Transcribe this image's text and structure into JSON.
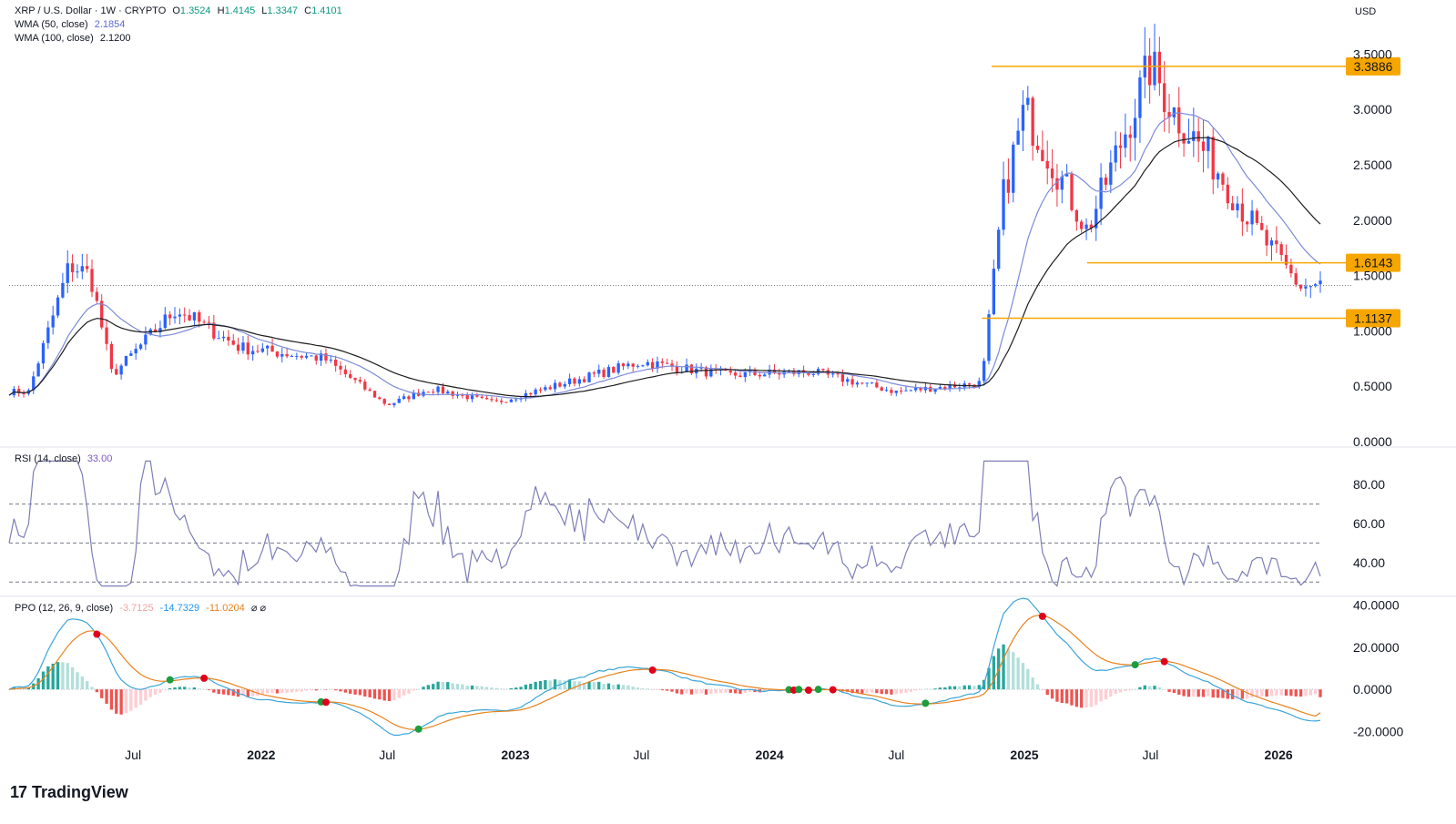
{
  "header": {
    "symbol": "XRP / U.S. Dollar · 1W · CRYPTO",
    "o_label": "O",
    "o_value": "1.3524",
    "h_label": "H",
    "h_value": "1.4145",
    "l_label": "L",
    "l_value": "1.3347",
    "c_label": "C",
    "c_value": "1.4101",
    "currency": "USD"
  },
  "indicators": {
    "wma50_label": "WMA (50, close)",
    "wma50_value": "2.1854",
    "wma100_label": "WMA (100, close)",
    "wma100_value": "2.1200",
    "rsi_label": "RSI (14, close)",
    "rsi_value": "33.00",
    "ppo_label": "PPO (12, 26, 9, close)",
    "ppo_hist": "-3.7125",
    "ppo_line": "-14.7329",
    "ppo_signal": "-11.0204",
    "ppo_icons": "⌀ ⌀"
  },
  "brand": {
    "name": "TradingView"
  },
  "colors": {
    "up": "#2962ff",
    "down": "#f23645",
    "wma50": "#7b8bd8",
    "wma100": "#1e1e1e",
    "level": "#f7a600",
    "rsi": "#7e7eb8",
    "ppo_line": "#3ca5d8",
    "ppo_signal": "#e8821e",
    "hist_up": "#26a69a",
    "hist_down": "#ef5350"
  },
  "chart_data": [
    {
      "type": "candlestick",
      "title": "XRP / U.S. Dollar · 1W · CRYPTO",
      "ylim": [
        0,
        3.7
      ],
      "y_ticks": [
        "0.0000",
        "0.5000",
        "1.0000",
        "1.5000",
        "2.0000",
        "2.5000",
        "3.0000",
        "3.5000"
      ],
      "x_ticks": [
        "Jul",
        "2022",
        "Jul",
        "2023",
        "Jul",
        "2024",
        "Jul",
        "2025",
        "Jul",
        "2026"
      ],
      "levels": [
        {
          "label": "3.3886",
          "value": 3.3886
        },
        {
          "label": "1.6143",
          "value": 1.6143
        },
        {
          "label": "1.1137",
          "value": 1.1137
        }
      ],
      "close_line": 1.41,
      "series_anchors": [
        {
          "name": "XRP",
          "date": [
            "2021-02",
            "2021-04",
            "2021-05",
            "2021-06",
            "2021-09",
            "2021-12",
            "2022-04",
            "2022-07",
            "2022-09",
            "2022-12",
            "2023-07",
            "2023-11",
            "2024-03",
            "2024-07",
            "2024-11",
            "2024-12",
            "2025-01",
            "2025-03",
            "2025-04",
            "2025-07",
            "2025-08",
            "2025-10",
            "2025-12",
            "2026-02",
            "2026-03"
          ],
          "close": [
            0.45,
            1.6,
            1.5,
            0.6,
            1.2,
            0.85,
            0.75,
            0.33,
            0.48,
            0.35,
            0.72,
            0.6,
            0.63,
            0.45,
            0.53,
            2.2,
            3.0,
            2.3,
            1.9,
            3.4,
            3.0,
            2.5,
            1.9,
            1.4,
            1.41
          ]
        },
        {
          "name": "WMA (50, close)",
          "value": 2.1854
        },
        {
          "name": "WMA (100, close)",
          "value": 2.12
        }
      ]
    },
    {
      "type": "line",
      "title": "RSI (14, close)",
      "ylim": [
        25,
        95
      ],
      "y_ticks": [
        "40.00",
        "60.00",
        "80.00"
      ],
      "bands": [
        70,
        50,
        30
      ],
      "last": 33.0
    },
    {
      "type": "bar",
      "title": "PPO (12, 26, 9, close)",
      "ylim": [
        -25,
        42
      ],
      "y_ticks": [
        "-20.0000",
        "0.0000",
        "20.0000",
        "40.0000"
      ],
      "series": [
        {
          "name": "histogram",
          "last": -3.7125
        },
        {
          "name": "ppo",
          "last": -14.7329
        },
        {
          "name": "signal",
          "last": -11.0204
        }
      ]
    }
  ]
}
